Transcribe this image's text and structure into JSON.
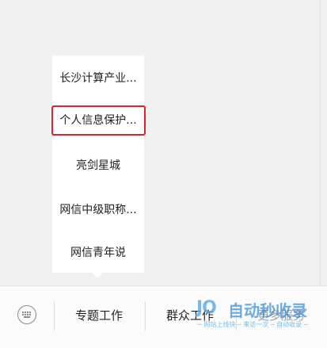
{
  "submenu": {
    "items": [
      {
        "label": "长沙计算产业..."
      },
      {
        "label": "个人信息保护..."
      },
      {
        "label": "亮剑星城"
      },
      {
        "label": "网信中级职称..."
      },
      {
        "label": "网信青年说"
      }
    ]
  },
  "menubar": {
    "keyboard_icon": "keyboard-icon",
    "tabs": [
      {
        "label": "专题工作"
      },
      {
        "label": "群众工作"
      },
      {
        "label": "更多服务"
      }
    ]
  },
  "watermark": {
    "logo": "JO",
    "title": "自动秒收录",
    "subtitle": "─ 网站上线快 ─ 来访一次 ─ 自动收录 ─"
  },
  "colors": {
    "highlight": "#e0202a",
    "watermark": "#3d8fd8"
  }
}
